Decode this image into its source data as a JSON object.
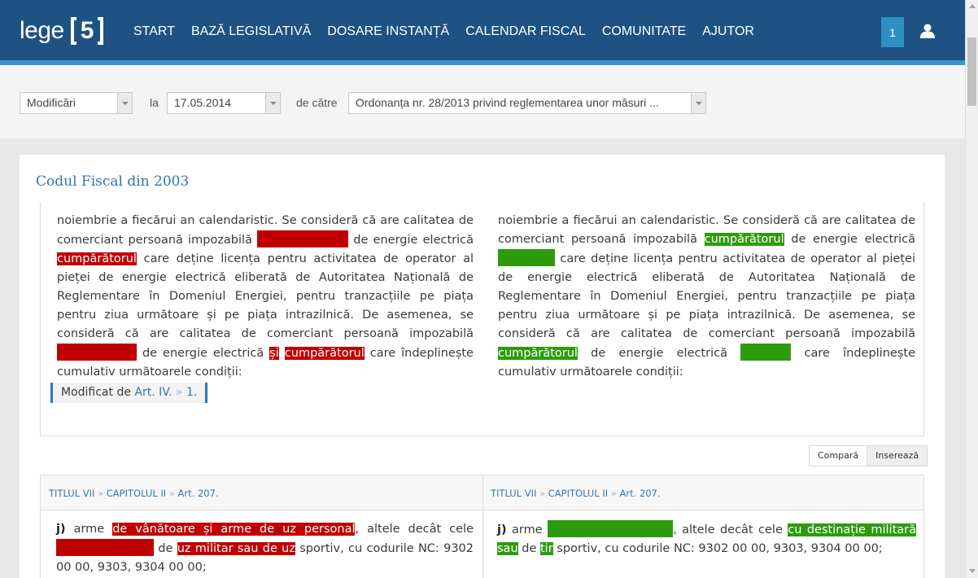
{
  "header": {
    "logo_word": "lege",
    "logo_number": "5",
    "nav": [
      "START",
      "BAZĂ LEGISLATIVĂ",
      "DOSARE INSTANȚĂ",
      "CALENDAR FISCAL",
      "COMUNITATE",
      "AJUTOR"
    ],
    "notification_count": "1",
    "user_icon": "user-icon"
  },
  "filters": {
    "mode_value": "Modificări",
    "date_label": "la",
    "date_value": "17.05.2014",
    "by_label": "de către",
    "act_value": "Ordonanța nr. 28/2013 privind reglementarea unor măsuri ..."
  },
  "document": {
    "title": "Codul Fiscal din 2003",
    "left": {
      "t1": "noiembrie a fiecărui an calendaristic. Se consideră că are calitatea de comerciant persoană impozabilă ",
      "t2": " de energie electrică ",
      "d1": "cumpărătorul",
      "t3": " care deține licența pentru activitatea de operator al pieței de energie electrică eliberată de Autoritatea Națională de Reglementare în Domeniul Energiei, pentru tranzacțiile pe piața pentru ziua următoare și pe piața intrazilnică. De asemenea, se consideră că are calitatea de comerciant persoană impozabilă ",
      "t4": " de energie electrică ",
      "d2": "și",
      "d3": "cumpărătorul",
      "t5": " care îndeplinește cumulativ următoarele condiții:"
    },
    "right": {
      "t1": "noiembrie a fiecărui an calendaristic. Se consideră că are calitatea de comerciant persoană impozabilă ",
      "i1": "cumpărătorul",
      "t2": " de energie electrică ",
      "t3": " care deține licența pentru activitatea de operator al pieței de energie electrică eliberată de Autoritatea Națională de Reglementare în Domeniul Energiei, pentru tranzacțiile pe piața pentru ziua următoare și pe piața intrazilnică. De asemenea, se consideră că are calitatea de comerciant persoană impozabilă ",
      "i2": "cumpărătorul",
      "t4": " de energie electrică ",
      "t5": " care îndeplinește cumulativ următoarele condiții:"
    },
    "modified_by": {
      "label": "Modificat de",
      "link1": "Art. IV.",
      "sep": "»",
      "link2": "1."
    }
  },
  "actions": {
    "compare": "Compară",
    "insert": "Inserează"
  },
  "section": {
    "crumbs_left": [
      "TITLUL VII",
      "CAPITOLUL II",
      "Art. 207."
    ],
    "crumbs_right": [
      "TITLUL VII",
      "CAPITOLUL II",
      "Art. 207."
    ],
    "crumb_sep": "»",
    "left": {
      "letter": "j)",
      "t1": " arme ",
      "d1": "de vânătoare și arme de uz personal",
      "t2": ", altele decât cele ",
      "t3": " de ",
      "d2": "uz militar sau de uz",
      "t4": " sportiv, cu codurile NC: 9302 00 00, 9303, 9304 00 00;"
    },
    "right": {
      "letter": "j)",
      "t1": " arme ",
      "t2": ", altele decât cele ",
      "i1": "cu destinație militară sau",
      "t3": " de ",
      "i2": "tir",
      "t4": " sportiv, cu codurile NC: 9302 00 00, 9303, 9304 00 00;"
    }
  },
  "colors": {
    "header": "#1e5283",
    "accent": "#3b95c8",
    "deleted": "#c00000",
    "inserted": "#2e9b0f",
    "link": "#2e77b4"
  }
}
